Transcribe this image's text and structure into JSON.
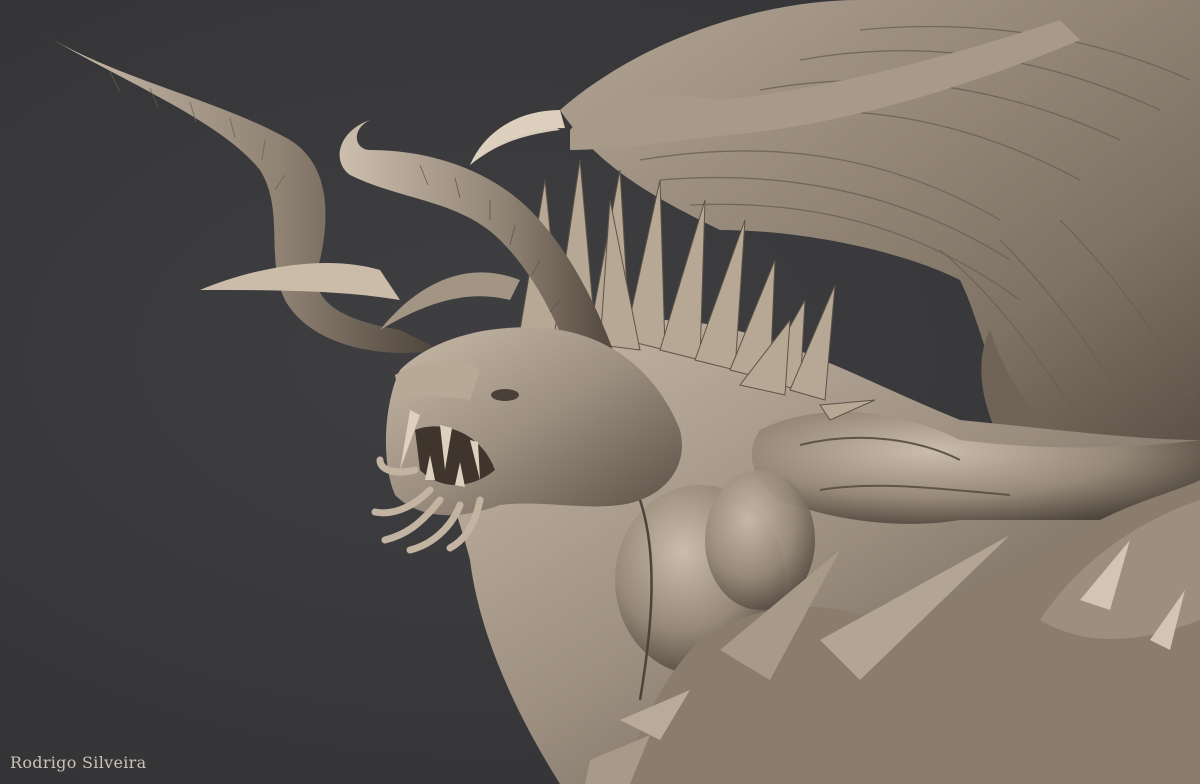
{
  "artwork": {
    "subject": "demon-dragon-sculpt",
    "background_color": "#3a3a3c",
    "clay_color": "#9c8f80",
    "clay_highlight": "#c9bba9",
    "clay_shadow": "#4a4038",
    "signature": "Rodrigo Silveira"
  }
}
